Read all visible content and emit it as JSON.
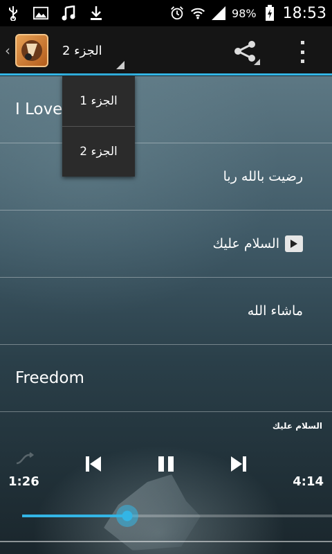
{
  "status_bar": {
    "battery_percent": "98%",
    "time": "18:53",
    "left_icons": [
      "usb-icon",
      "image-icon",
      "music-icon",
      "download-icon"
    ],
    "right_icons": [
      "alarm-icon",
      "wifi-icon",
      "signal-icon",
      "battery-icon"
    ]
  },
  "action_bar": {
    "spinner_label": "الجزء 2"
  },
  "dropdown": {
    "items": [
      "الجزء 1",
      "الجزء 2"
    ]
  },
  "list": {
    "items": [
      {
        "label": "I Love",
        "dir": "ltr"
      },
      {
        "label": "رضيت بالله ربا",
        "dir": "rtl"
      },
      {
        "label": "السلام عليك",
        "dir": "rtl",
        "playing": true
      },
      {
        "label": "ماشاء الله",
        "dir": "rtl"
      },
      {
        "label": "Freedom",
        "dir": "ltr"
      }
    ]
  },
  "player": {
    "now_playing": "السلام عليك",
    "elapsed": "1:26",
    "duration": "4:14",
    "progress_fraction": 0.34
  },
  "colors": {
    "accent": "#33b5e5"
  }
}
